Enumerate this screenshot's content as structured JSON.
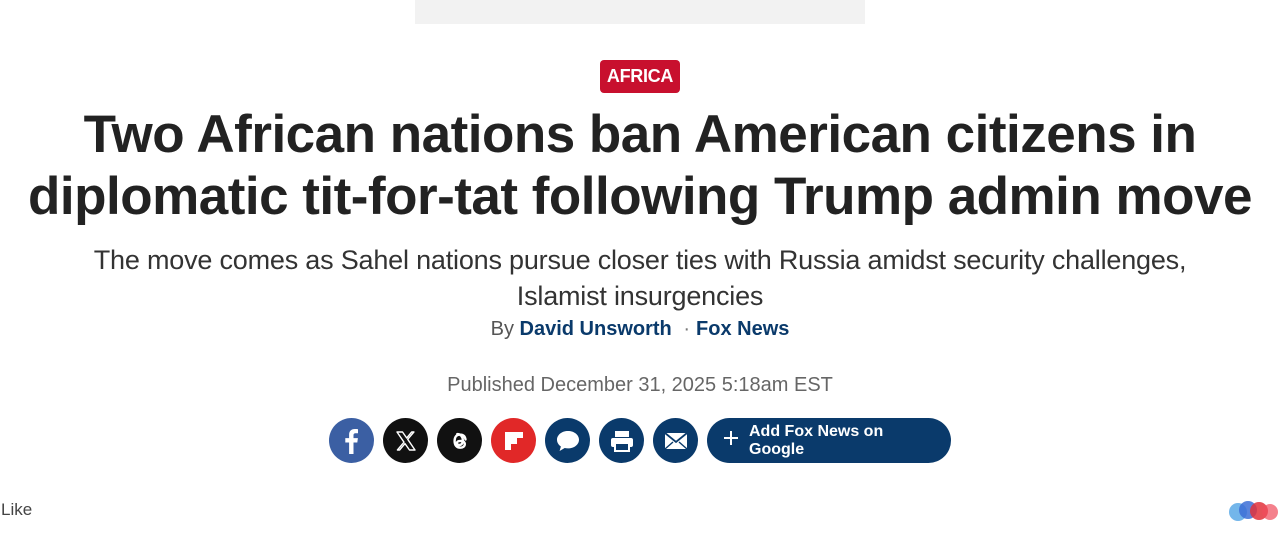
{
  "category": {
    "label": "AFRICA",
    "color": "#c8102e"
  },
  "article": {
    "headline": "Two African nations ban American citizens in diplomatic tit-for-tat following Trump admin move",
    "subheadline": "The move comes as Sahel nations pursue closer ties with Russia amidst security challenges, Islamist insurgencies",
    "byline": {
      "prefix": "By",
      "author": "David Unsworth",
      "separator": "·",
      "outlet": "Fox News"
    },
    "published": "Published December 31, 2025 5:18am EST"
  },
  "share": {
    "buttons": [
      {
        "name": "facebook",
        "icon": "facebook-icon"
      },
      {
        "name": "x",
        "icon": "x-icon"
      },
      {
        "name": "threads",
        "icon": "threads-icon"
      },
      {
        "name": "flipboard",
        "icon": "flipboard-icon"
      },
      {
        "name": "comments",
        "icon": "comment-icon"
      },
      {
        "name": "print",
        "icon": "print-icon"
      },
      {
        "name": "email",
        "icon": "email-icon"
      }
    ],
    "google_label": "Add Fox News on Google",
    "brand_color": "#0a3a6b"
  },
  "footer": {
    "like_label": "Like"
  }
}
